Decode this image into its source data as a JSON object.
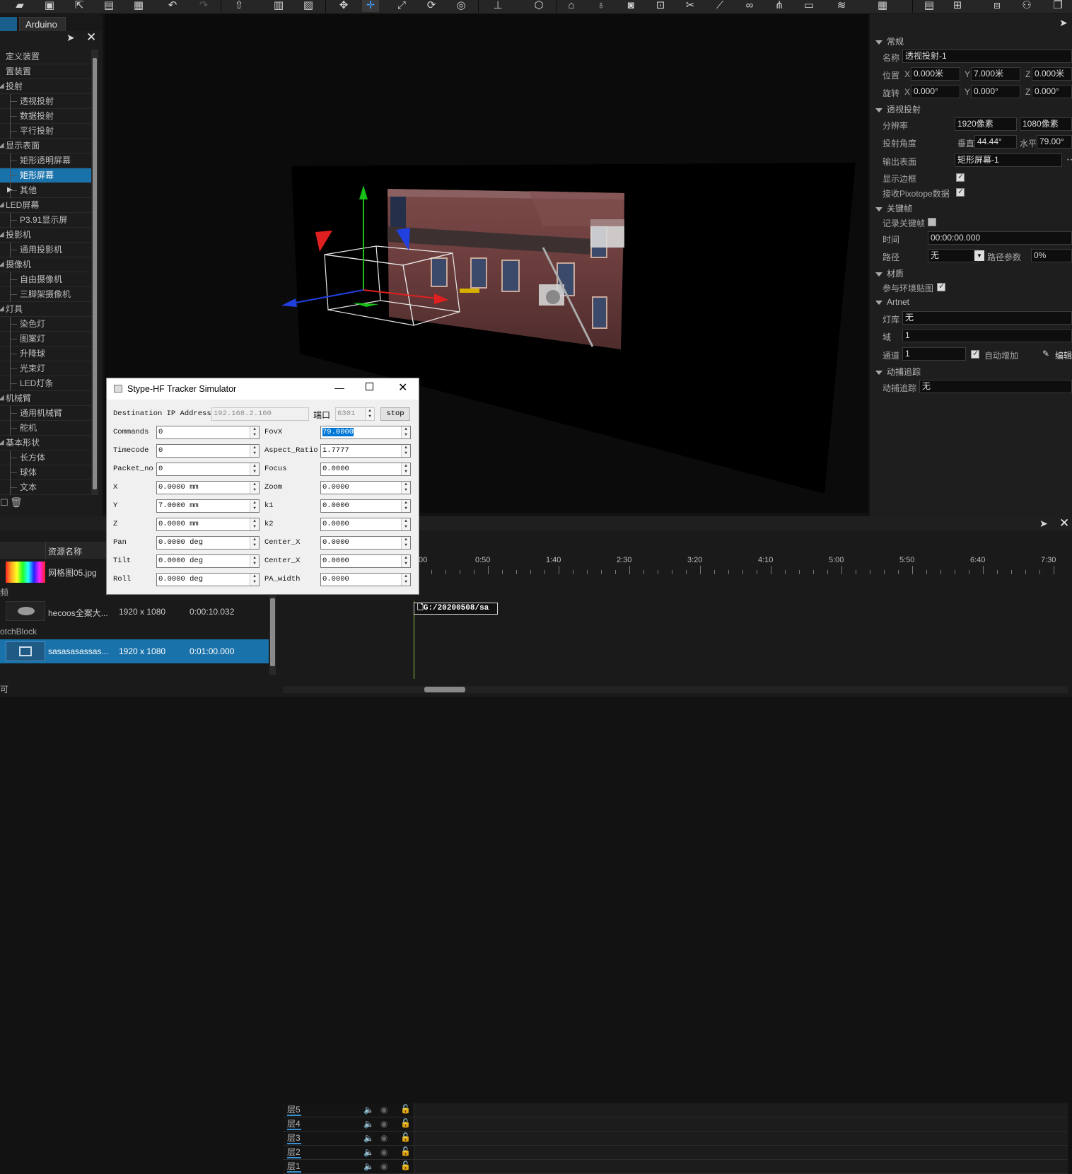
{
  "left_panel": {
    "tabs": [
      "",
      "Arduino"
    ],
    "tree": [
      {
        "label": "定义装置",
        "level": 1,
        "arrow": false
      },
      {
        "label": "置装置",
        "level": 1,
        "arrow": false
      },
      {
        "label": "投射",
        "level": 1,
        "arrow": true
      },
      {
        "label": "透视投射",
        "level": 2
      },
      {
        "label": "数据投射",
        "level": 2
      },
      {
        "label": "平行投射",
        "level": 2
      },
      {
        "label": "显示表面",
        "level": 1,
        "arrow": true
      },
      {
        "label": "矩形透明屏幕",
        "level": 2
      },
      {
        "label": "矩形屏幕",
        "level": 2,
        "selected": true
      },
      {
        "label": "其他",
        "level": 2,
        "expander": true
      },
      {
        "label": "LED屏幕",
        "level": 1,
        "arrow": true
      },
      {
        "label": "P3.91显示屏",
        "level": 2
      },
      {
        "label": "投影机",
        "level": 1,
        "arrow": true
      },
      {
        "label": "通用投影机",
        "level": 2
      },
      {
        "label": "摄像机",
        "level": 1,
        "arrow": true
      },
      {
        "label": "自由摄像机",
        "level": 2
      },
      {
        "label": "三脚架摄像机",
        "level": 2
      },
      {
        "label": "灯具",
        "level": 1,
        "arrow": true
      },
      {
        "label": "染色灯",
        "level": 2
      },
      {
        "label": "图案灯",
        "level": 2
      },
      {
        "label": "升降球",
        "level": 2
      },
      {
        "label": "光束灯",
        "level": 2
      },
      {
        "label": "LED灯条",
        "level": 2
      },
      {
        "label": "机械臂",
        "level": 1,
        "arrow": true
      },
      {
        "label": "通用机械臂",
        "level": 2
      },
      {
        "label": "舵机",
        "level": 2
      },
      {
        "label": "基本形状",
        "level": 1,
        "arrow": true
      },
      {
        "label": "长方体",
        "level": 2
      },
      {
        "label": "球体",
        "level": 2
      },
      {
        "label": "文本",
        "level": 2
      }
    ]
  },
  "properties": {
    "general": {
      "title": "常规",
      "name_label": "名称",
      "name": "透视投射-1",
      "pos_label": "位置",
      "pos": {
        "x": "0.000米",
        "y": "7.000米",
        "z": "0.000米"
      },
      "rot_label": "旋转",
      "rot": {
        "x": "0.000°",
        "y": "0.000°",
        "z": "0.000°"
      }
    },
    "projection": {
      "title": "透视投射",
      "res_label": "分辨率",
      "res_w": "1920像素",
      "res_h": "1080像素",
      "angle_label": "投射角度",
      "vert_label": "垂直",
      "vert": "44.44°",
      "horiz_label": "水平",
      "horiz": "79.00°",
      "surface_label": "输出表面",
      "surface": "矩形屏幕-1",
      "border_label": "显示边框",
      "pixotope_label": "接收Pixotope数据"
    },
    "keyframe": {
      "title": "关键帧",
      "record_label": "记录关键帧",
      "time_label": "时间",
      "time": "00:00:00.000",
      "path_label": "路径",
      "path": "无",
      "path_param_label": "路径参数",
      "path_param": "0%"
    },
    "material": {
      "title": "材质",
      "env_label": "参与环境贴图"
    },
    "artnet": {
      "title": "Artnet",
      "lib_label": "灯库",
      "lib": "无",
      "domain_label": "域",
      "domain": "1",
      "channel_label": "通道",
      "channel": "1",
      "auto_label": "自动增加",
      "edit_label": "编辑"
    },
    "mocap": {
      "title": "动捕追踪",
      "label": "动捕追踪",
      "value": "无"
    }
  },
  "dialog": {
    "title": "Stype-HF Tracker Simulator",
    "ip_label": "Destination IP Address",
    "ip": "192.168.2.160",
    "port_label": "端口",
    "port": "6301",
    "stop_label": "stop",
    "left_fields": [
      {
        "label": "Commands",
        "value": "0"
      },
      {
        "label": "Timecode",
        "value": "0"
      },
      {
        "label": "Packet_no",
        "value": "0"
      },
      {
        "label": "X",
        "value": "0.0000 mm"
      },
      {
        "label": "Y",
        "value": "7.0000 mm"
      },
      {
        "label": "Z",
        "value": "0.0000 mm"
      },
      {
        "label": "Pan",
        "value": "0.0000 deg"
      },
      {
        "label": "Tilt",
        "value": "0.0000 deg"
      },
      {
        "label": "Roll",
        "value": "0.0000 deg"
      }
    ],
    "right_fields": [
      {
        "label": "FovX",
        "value": "79.0000",
        "selected": true
      },
      {
        "label": "Aspect_Ratio",
        "value": "1.7777"
      },
      {
        "label": "Focus",
        "value": "0.0000"
      },
      {
        "label": "Zoom",
        "value": "0.0000"
      },
      {
        "label": "k1",
        "value": "0.0000"
      },
      {
        "label": "k2",
        "value": "0.0000"
      },
      {
        "label": "Center_X",
        "value": "0.0000"
      },
      {
        "label": "Center_X",
        "value": "0.0000"
      },
      {
        "label": "PA_width",
        "value": "0.0000"
      }
    ]
  },
  "assets": {
    "header": "资源名称",
    "group_video": "频",
    "group_patch": "otchBlock",
    "items": [
      {
        "name": "网格图05.jpg",
        "res": "",
        "dur": "",
        "thumb": "rainbow"
      },
      {
        "name": "hecoos全案大...",
        "res": "1920 x 1080",
        "dur": "0:00:10.032",
        "thumb": "video"
      },
      {
        "name": "sasasasassas...",
        "res": "1920 x 1080",
        "dur": "0:01:00.000",
        "thumb": "patch",
        "selected": true
      }
    ],
    "footer": "可"
  },
  "timeline": {
    "ruler": [
      "00",
      "0:50",
      "1:40",
      "2:30",
      "3:20",
      "4:10",
      "5:00",
      "5:50",
      "6:40",
      "7:30"
    ],
    "layers": [
      "层5",
      "层4",
      "层3",
      "层2",
      "层1"
    ],
    "clip": "G:/20200508/sa"
  }
}
